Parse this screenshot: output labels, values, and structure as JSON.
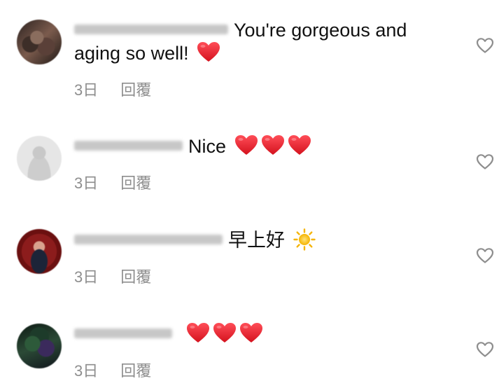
{
  "comments": [
    {
      "text_line1": "You're gorgeous and",
      "text_line2": "aging so well!",
      "emoji": [
        "red-heart"
      ],
      "time": "3日",
      "reply": "回覆"
    },
    {
      "text_line1": "Nice",
      "emoji": [
        "red-heart",
        "red-heart",
        "red-heart"
      ],
      "time": "3日",
      "reply": "回覆"
    },
    {
      "text_line1": "早上好",
      "emoji": [
        "sun"
      ],
      "time": "3日",
      "reply": "回覆"
    },
    {
      "text_line1": "",
      "emoji": [
        "red-heart",
        "red-heart",
        "red-heart"
      ],
      "time": "3日",
      "reply": "回覆"
    }
  ],
  "colors": {
    "heart_emoji": "#e0202c",
    "meta_text": "#8e8e8e",
    "like_icon_stroke": "#8e8e8e"
  },
  "icons": {
    "like": "heart-outline-icon",
    "avatar": "blurred-avatar"
  }
}
